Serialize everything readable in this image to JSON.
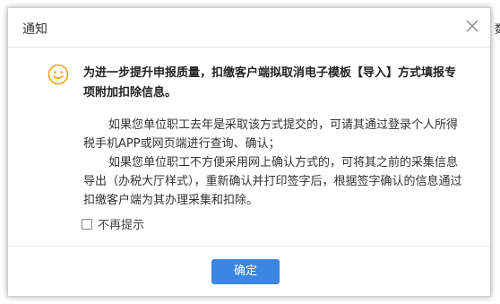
{
  "dialog": {
    "title": "通知",
    "headline": "为进一步提升申报质量，扣缴客户端拟取消电子模板【导入】方式填报专项附加扣除信息。",
    "paragraphs": [
      "如果您单位职工去年是采取该方式提交的，可请其通过登录个人所得税手机APP或网页端进行查询、确认；",
      "如果您单位职工不方便采用网上确认方式的，可将其之前的采集信息导出（办税大厅样式），重新确认并打印签字后，根据签字确认的信息通过扣缴客户端为其办理采集和扣除。"
    ],
    "checkbox_label": "不再提示",
    "confirm_label": "确定"
  },
  "background": {
    "edge_text": "数"
  },
  "colors": {
    "accent": "#3a86e0",
    "icon": "#f0a020"
  },
  "icons": {
    "close": "close-icon",
    "smile": "smile-icon"
  }
}
